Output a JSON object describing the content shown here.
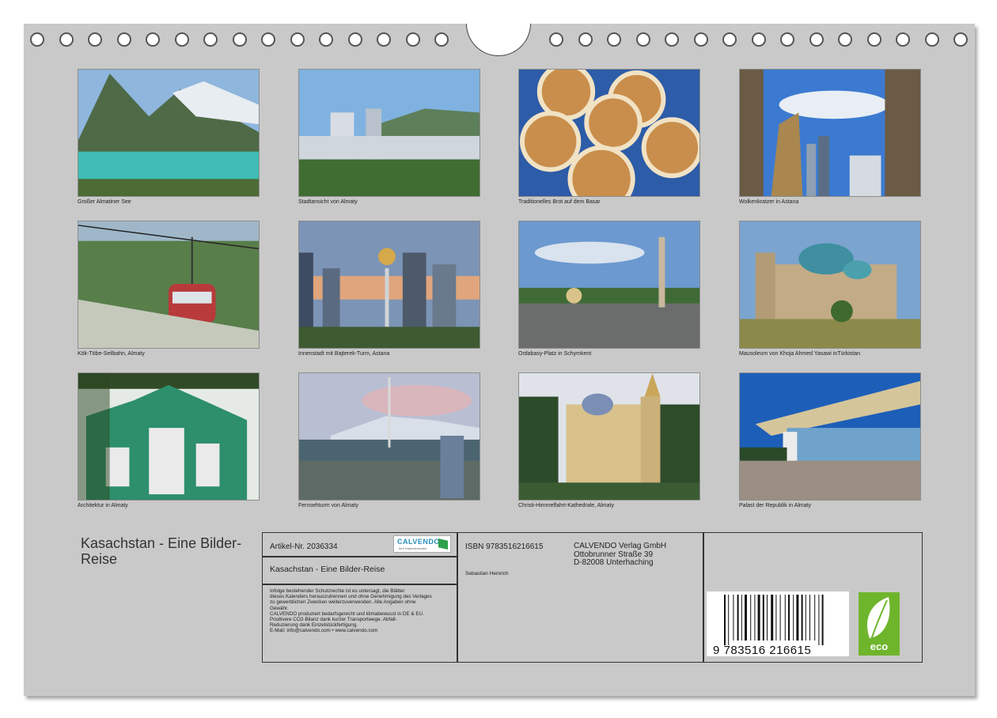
{
  "ring_count_left": 15,
  "ring_count_right": 15,
  "photos": [
    {
      "caption": "Großer Almatiner See",
      "scene": "mountain-lake"
    },
    {
      "caption": "Stadtansicht von Almaty",
      "scene": "city-view"
    },
    {
      "caption": "Traditionelles Brot auf dem Basar",
      "scene": "bread"
    },
    {
      "caption": "Wolkenkratzer in Astana",
      "scene": "skyscrapers"
    },
    {
      "caption": "Kök-Töbe-Seilbahn, Almaty",
      "scene": "cable-car"
    },
    {
      "caption": "Innenstadt mit Bajterek-Turm, Astana",
      "scene": "bayterek"
    },
    {
      "caption": "Ordabasy-Platz in Schymkent",
      "scene": "square"
    },
    {
      "caption": "Mausoleum von Khoja Ahmed Yasawi inTürkistan",
      "scene": "mausoleum"
    },
    {
      "caption": "Architektur in Almaty",
      "scene": "green-building"
    },
    {
      "caption": "Fernsehturm von Almaty",
      "scene": "tv-tower"
    },
    {
      "caption": "Christi-Himmelfahrt-Kathedrale, Almaty",
      "scene": "cathedral"
    },
    {
      "caption": "Palast der Republik in Almaty",
      "scene": "palace"
    }
  ],
  "title": "Kasachstan - Eine Bilder-Reise",
  "info": {
    "article_number": "Artikel-Nr. 2036334",
    "calvendo_logo": "CALVENDO",
    "calvendo_tagline": "Ihre Kalendermarke",
    "product_title": "Kasachstan - Eine Bilder-Reise",
    "legal_text_lines": [
      "Infolge bestehender Schutzrechte ist es untersagt, die Blätter",
      "dieses Kalenders herauszutrennen und ohne Genehmigung des Verlages",
      "zu gewerblichen Zwecken weiterzuverwenden. Alle Angaben ohne",
      "Gewähr.",
      "CALVENDO produziert bedarfsgerecht und klimabewusst in DE & EU.",
      "Positivere CO2-Bilanz dank kurzer Transportwege. Abfall-",
      "Reduzierung dank Einzelstückfertigung.",
      "E-Mail: info@calvendo.com • www.calvendo.com"
    ],
    "isbn": "ISBN 9783516216615",
    "publisher_lines": [
      "CALVENDO Verlag GmbH",
      "Ottobrunner Straße 39",
      "D-82008 Unterhaching"
    ],
    "author": "Sebastian Heinrich",
    "barcode_digits": "9 783516 216615",
    "eco_label": "eco"
  }
}
